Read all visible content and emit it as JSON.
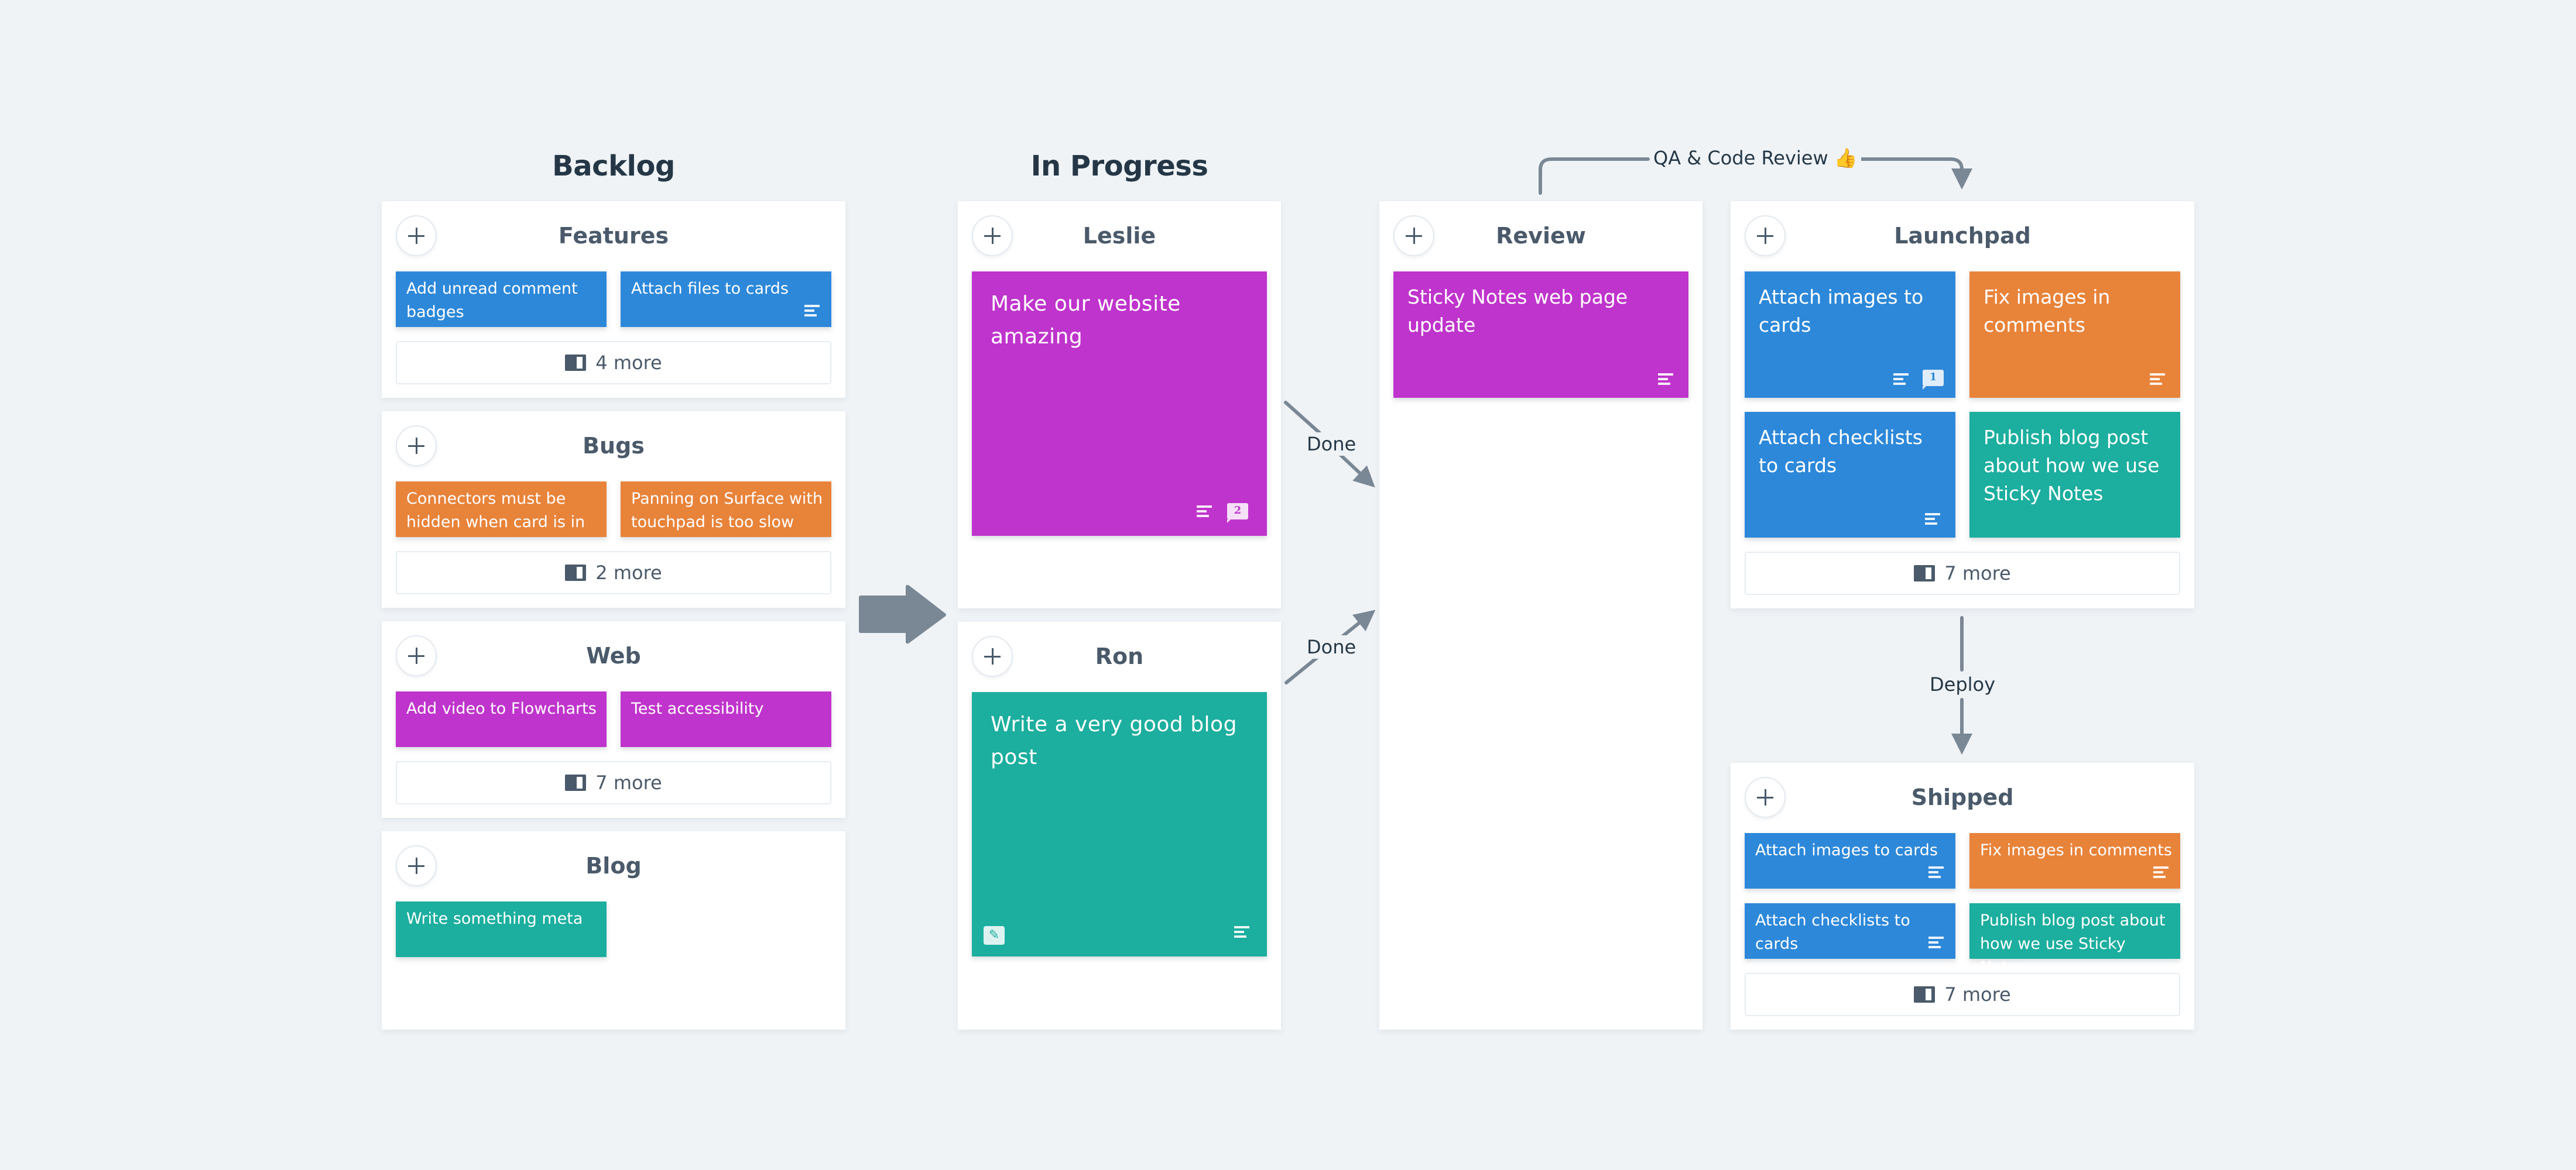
{
  "colors": {
    "blue": "#2d88d9",
    "orange": "#e8833a",
    "magenta": "#bf34cc",
    "teal": "#1cae9e",
    "connector": "#7a8795",
    "background": "#eff3f6"
  },
  "columns": {
    "backlog": "Backlog",
    "in_progress": "In Progress"
  },
  "panels": {
    "features": {
      "title": "Features",
      "cards": [
        {
          "text": "Add unread comment badges",
          "color": "blue"
        },
        {
          "text": "Attach files to cards",
          "color": "blue",
          "icons": [
            "notes-icon"
          ]
        }
      ],
      "more": "4 more"
    },
    "bugs": {
      "title": "Bugs",
      "cards": [
        {
          "text": "Connectors must be hidden when card is in ...",
          "color": "orange"
        },
        {
          "text": "Panning on Surface with touchpad is too slow",
          "color": "orange"
        }
      ],
      "more": "2 more"
    },
    "web": {
      "title": "Web",
      "cards": [
        {
          "text": "Add video to Flowcharts",
          "color": "magenta"
        },
        {
          "text": "Test accessibility",
          "color": "magenta"
        }
      ],
      "more": "7 more"
    },
    "blog": {
      "title": "Blog",
      "cards": [
        {
          "text": "Write something meta",
          "color": "teal"
        }
      ]
    },
    "leslie": {
      "title": "Leslie",
      "cards": [
        {
          "text": "Make our website amazing",
          "color": "magenta",
          "icons": [
            "notes-icon",
            "comment-icon"
          ],
          "comment_count": "2"
        }
      ]
    },
    "ron": {
      "title": "Ron",
      "cards": [
        {
          "text": "Write a very good blog post",
          "color": "teal",
          "icons": [
            "edit-icon",
            "notes-icon"
          ]
        }
      ]
    },
    "review": {
      "title": "Review",
      "cards": [
        {
          "text": "Sticky Notes web page update",
          "color": "magenta",
          "icons": [
            "notes-icon"
          ]
        }
      ]
    },
    "launchpad": {
      "title": "Launchpad",
      "cards": [
        {
          "text": "Attach images to cards",
          "color": "blue",
          "icons": [
            "notes-icon",
            "comment-icon"
          ],
          "comment_count": "1"
        },
        {
          "text": "Fix images in comments",
          "color": "orange",
          "icons": [
            "notes-icon"
          ]
        },
        {
          "text": "Attach checklists to cards",
          "color": "blue",
          "icons": [
            "notes-icon"
          ]
        },
        {
          "text": "Publish blog post about how we use Sticky Notes",
          "color": "teal"
        }
      ],
      "more": "7 more"
    },
    "shipped": {
      "title": "Shipped",
      "cards": [
        {
          "text": "Attach images to cards",
          "color": "blue",
          "icons": [
            "notes-icon"
          ]
        },
        {
          "text": "Fix images in comments",
          "color": "orange",
          "icons": [
            "notes-icon"
          ]
        },
        {
          "text": "Attach checklists to cards",
          "color": "blue",
          "icons": [
            "notes-icon"
          ]
        },
        {
          "text": "Publish blog post about how we use Sticky Notes",
          "color": "teal"
        }
      ],
      "more": "7 more"
    }
  },
  "connectors": {
    "done_top": "Done",
    "done_bottom": "Done",
    "qa_review": "QA & Code Review",
    "qa_emoji": "👍",
    "deploy": "Deploy"
  }
}
